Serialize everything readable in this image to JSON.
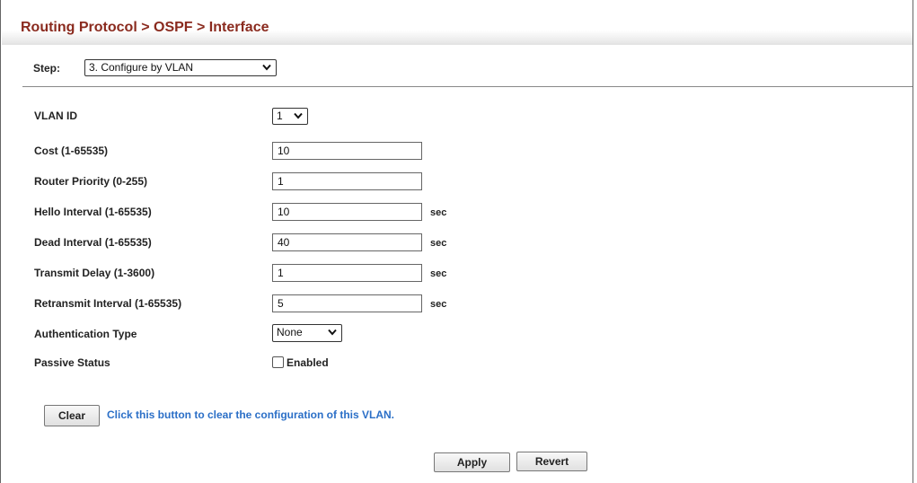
{
  "breadcrumb": "Routing Protocol > OSPF > Interface",
  "step": {
    "label": "Step:",
    "value": "3. Configure by VLAN"
  },
  "vlan": {
    "label": "VLAN ID",
    "value": "1"
  },
  "fields": [
    {
      "label": "Cost (1-65535)",
      "value": "10",
      "unit": ""
    },
    {
      "label": "Router Priority (0-255)",
      "value": "1",
      "unit": ""
    },
    {
      "label": "Hello Interval (1-65535)",
      "value": "10",
      "unit": "sec"
    },
    {
      "label": "Dead Interval (1-65535)",
      "value": "40",
      "unit": "sec"
    },
    {
      "label": "Transmit Delay (1-3600)",
      "value": "1",
      "unit": "sec"
    },
    {
      "label": "Retransmit Interval (1-65535)",
      "value": "5",
      "unit": "sec"
    }
  ],
  "auth": {
    "label": "Authentication Type",
    "value": "None"
  },
  "passive": {
    "label": "Passive Status",
    "checkbox_label": "Enabled",
    "checked": false
  },
  "clear": {
    "button": "Clear",
    "hint": "Click this button to clear the configuration of this VLAN."
  },
  "actions": {
    "apply": "Apply",
    "revert": "Revert"
  },
  "colors": {
    "title": "#8a2a1e",
    "hint": "#2b6fc7"
  }
}
